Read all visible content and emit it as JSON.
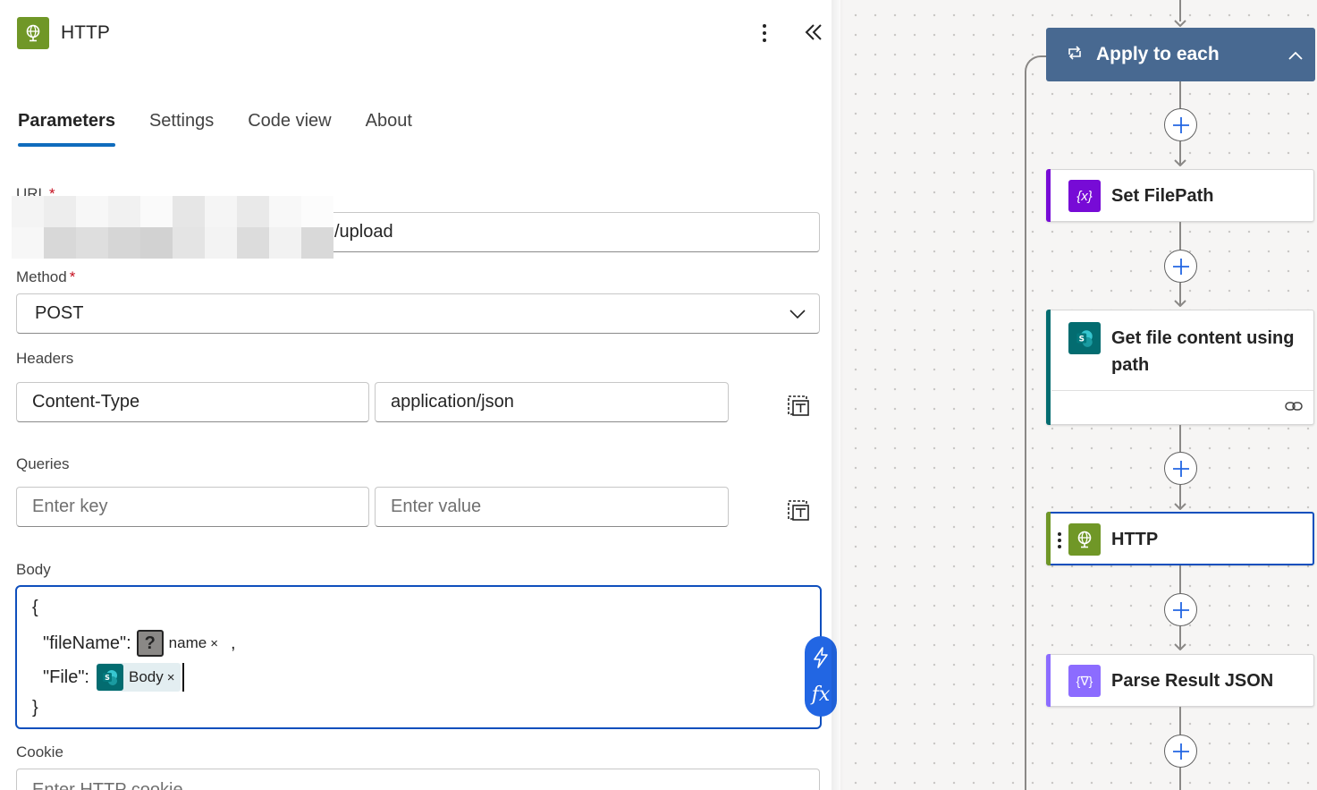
{
  "panel": {
    "title": "HTTP",
    "tabs": [
      {
        "label": "Parameters",
        "active": true
      },
      {
        "label": "Settings",
        "active": false
      },
      {
        "label": "Code view",
        "active": false
      },
      {
        "label": "About",
        "active": false
      }
    ],
    "url": {
      "label": "URL",
      "required_mark": "*",
      "value_visible": "/upload"
    },
    "method": {
      "label": "Method",
      "required_mark": "*",
      "value": "POST"
    },
    "headers": {
      "label": "Headers",
      "key": "Content-Type",
      "value": "application/json"
    },
    "queries": {
      "label": "Queries",
      "key_placeholder": "Enter key",
      "value_placeholder": "Enter value"
    },
    "body": {
      "label": "Body",
      "line1": "{",
      "line2_key": "\"fileName\":",
      "line2_token": "name",
      "line2_suffix": ",",
      "line3_key": "\"File\":",
      "line3_token": "Body",
      "line4": "}",
      "token_remove": "×"
    },
    "cookie": {
      "label": "Cookie",
      "placeholder": "Enter HTTP cookie"
    },
    "colors": {
      "http_icon": "#709727",
      "accent_blue": "#0f6cbd",
      "selected_border": "#0f4fbd"
    }
  },
  "flow": {
    "apply_to_each": {
      "title": "Apply to each",
      "color": "#486991"
    },
    "steps": [
      {
        "title": "Set FilePath",
        "icon": "variable-icon",
        "accent": "#770bd6"
      },
      {
        "title": "Get file content using path",
        "icon": "sharepoint-icon",
        "accent": "#036c70"
      },
      {
        "title": "HTTP",
        "icon": "http-globe-icon",
        "accent": "#709727",
        "selected": true
      },
      {
        "title": "Parse Result JSON",
        "icon": "data-operation-icon",
        "accent": "#8c6cff"
      }
    ]
  }
}
